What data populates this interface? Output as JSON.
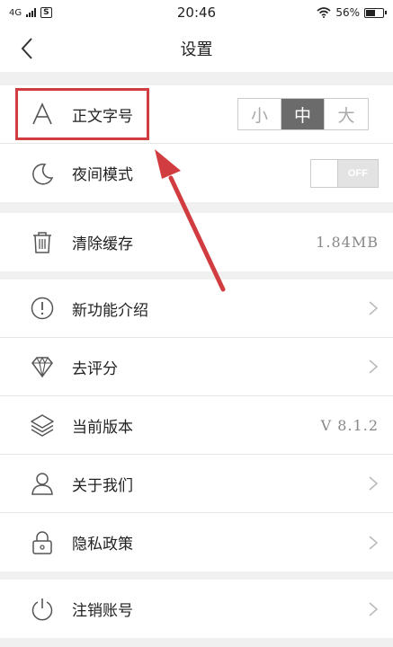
{
  "status_bar": {
    "network": "4G",
    "badge": "S",
    "time": "20:46",
    "battery": "56%",
    "battery_level": 0.56
  },
  "nav": {
    "title": "设置"
  },
  "settings": {
    "font_size": {
      "label": "正文字号",
      "options": [
        "小",
        "中",
        "大"
      ],
      "selected": "中"
    },
    "night_mode": {
      "label": "夜间模式",
      "toggle_text": "OFF"
    },
    "clear_cache": {
      "label": "清除缓存",
      "value": "1.84MB"
    },
    "new_features": {
      "label": "新功能介绍"
    },
    "rate": {
      "label": "去评分"
    },
    "version": {
      "label": "当前版本",
      "value": "V 8.1.2"
    },
    "about": {
      "label": "关于我们"
    },
    "privacy": {
      "label": "隐私政策"
    },
    "logout": {
      "label": "注销账号"
    }
  },
  "colors": {
    "highlight": "#d13c40",
    "segment_active": "#6b6b6b",
    "background": "#f0f0f0"
  }
}
